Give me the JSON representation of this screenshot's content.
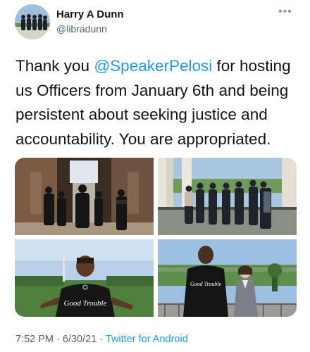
{
  "tweet": {
    "author": {
      "display_name": "Harry A Dunn",
      "handle": "@libradunn"
    },
    "more_icon": "more-horizontal-icon",
    "text": {
      "before_mention": "Thank you ",
      "mention": "@SpeakerPelosi",
      "after_mention": " for hosting us Officers from January 6th and being persistent about seeking justice and accountability. You are appropriated."
    },
    "photos": [
      {
        "id": "hallway-doorway"
      },
      {
        "id": "group-on-balcony"
      },
      {
        "id": "man-pointing-at-shirt"
      },
      {
        "id": "man-and-woman-balcony"
      }
    ],
    "shirt_text": "Good Trouble",
    "meta": {
      "time": "7:52 PM",
      "separator": " · ",
      "date": "6/30/21",
      "source": "Twitter for Android"
    }
  },
  "colors": {
    "link": "#1d9bf0",
    "text": "#0f1419",
    "secondary": "#536471"
  }
}
